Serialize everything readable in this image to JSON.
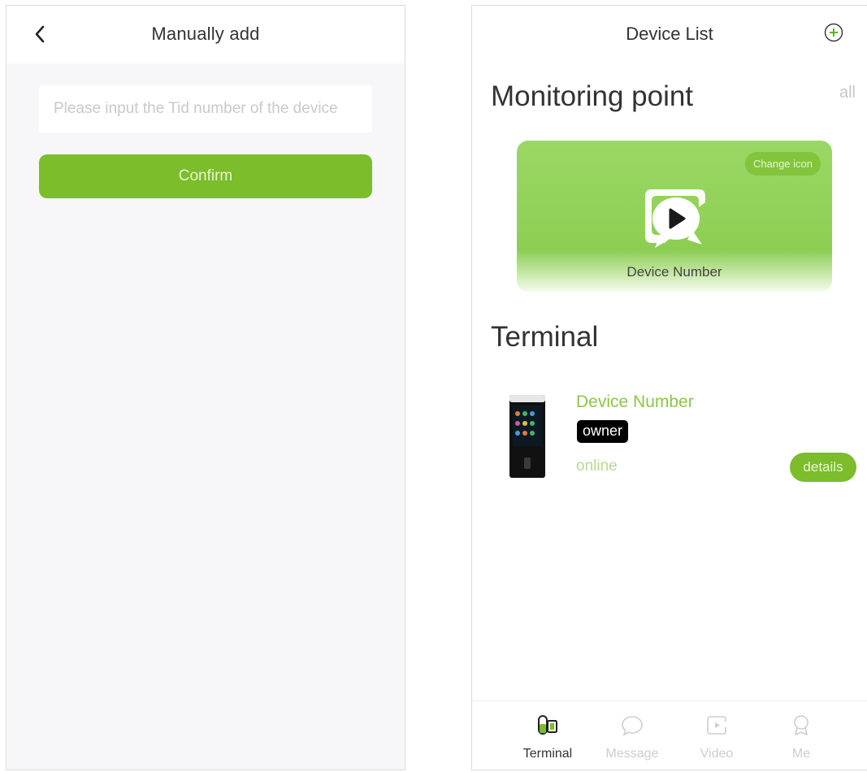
{
  "manual_add": {
    "title": "Manually add",
    "tid_input": {
      "value": "",
      "placeholder": "Please input the Tid number of the device"
    },
    "confirm_label": "Confirm"
  },
  "device_list": {
    "title": "Device List",
    "monitoring_section": {
      "title": "Monitoring point",
      "all_label": "all",
      "card": {
        "change_icon_label": "Change icon",
        "device_label": "Device Number"
      }
    },
    "terminal_section": {
      "title": "Terminal",
      "device": {
        "name": "Device Number",
        "role": "owner",
        "status": "online",
        "details_label": "details"
      }
    },
    "tabs": [
      {
        "label": "Terminal",
        "icon": "terminal-icon",
        "active": true
      },
      {
        "label": "Message",
        "icon": "message-icon",
        "active": false
      },
      {
        "label": "Video",
        "icon": "video-icon",
        "active": false
      },
      {
        "label": "Me",
        "icon": "me-icon",
        "active": false
      }
    ]
  },
  "colors": {
    "accent_green": "#7bbd2a",
    "light_green_text": "#8bc64a",
    "inactive_tab": "#cdcdcd"
  }
}
